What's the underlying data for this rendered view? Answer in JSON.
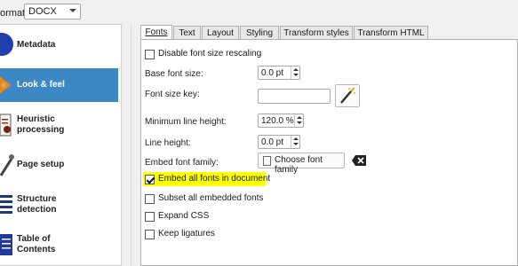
{
  "toolbar": {
    "format_label": "ormat:",
    "format_value": "DOCX"
  },
  "sidebar": {
    "items": [
      {
        "label_line1": "Metadata",
        "label_line2": "",
        "icon": "metadata-icon",
        "active": false
      },
      {
        "label_line1": "Look & feel",
        "label_line2": "",
        "icon": "look-and-feel-icon",
        "active": true
      },
      {
        "label_line1": "Heuristic",
        "label_line2": "processing",
        "icon": "heuristic-processing-icon",
        "active": false
      },
      {
        "label_line1": "Page setup",
        "label_line2": "",
        "icon": "page-setup-icon",
        "active": false
      },
      {
        "label_line1": "Structure",
        "label_line2": "detection",
        "icon": "structure-detection-icon",
        "active": false
      },
      {
        "label_line1": "Table of",
        "label_line2": "Contents",
        "icon": "table-of-contents-icon",
        "active": false
      }
    ]
  },
  "tabs": [
    "Fonts",
    "Text",
    "Layout",
    "Styling",
    "Transform styles",
    "Transform HTML"
  ],
  "active_tab": "Fonts",
  "fonts": {
    "disable_rescaling": {
      "label": "Disable font size rescaling",
      "checked": false
    },
    "base_font_size": {
      "label": "Base font size:",
      "value": "0.0 pt"
    },
    "font_size_key": {
      "label": "Font size key:",
      "value": ""
    },
    "min_line_height": {
      "label": "Minimum line height:",
      "value": "120.0 %"
    },
    "line_height": {
      "label": "Line height:",
      "value": "0.0 pt"
    },
    "embed_font_family": {
      "label": "Embed font family:",
      "button": "Choose font family"
    },
    "embed_all_fonts": {
      "label": "Embed all fonts in document",
      "checked": true
    },
    "subset_fonts": {
      "label": "Subset all embedded fonts",
      "checked": false
    },
    "expand_css": {
      "label": "Expand CSS",
      "checked": false
    },
    "keep_ligatures": {
      "label": "Keep ligatures",
      "checked": false
    }
  },
  "colors": {
    "sidebar_active": "#3c88c4",
    "highlight": "#ffff00"
  }
}
